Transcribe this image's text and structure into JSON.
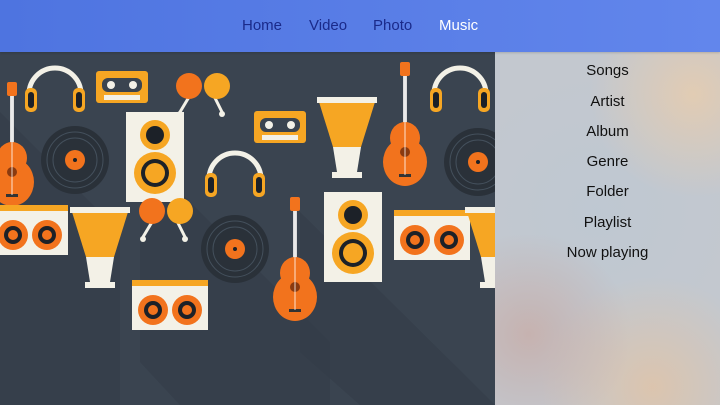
{
  "nav": {
    "tabs": [
      {
        "label": "Home"
      },
      {
        "label": "Video"
      },
      {
        "label": "Photo"
      },
      {
        "label": "Music",
        "active": true
      }
    ]
  },
  "music_menu": {
    "items": [
      {
        "label": "Songs"
      },
      {
        "label": "Artist"
      },
      {
        "label": "Album"
      },
      {
        "label": "Genre"
      },
      {
        "label": "Folder"
      },
      {
        "label": "Playlist"
      },
      {
        "label": "Now playing"
      }
    ]
  },
  "artwork": {
    "icons": [
      "guitar-icon",
      "headphones-icon",
      "cassette-icon",
      "maracas-icon",
      "speaker-icon",
      "vinyl-record-icon",
      "djembe-drum-icon",
      "boombox-icon"
    ]
  },
  "colors": {
    "topbar": "#5a7de8",
    "active_tab": "#ffffff",
    "inactive_tab": "#1a2a8a",
    "artwork_background": "#3a4450",
    "accent_orange": "#f2731d",
    "accent_yellow": "#f6a623"
  }
}
